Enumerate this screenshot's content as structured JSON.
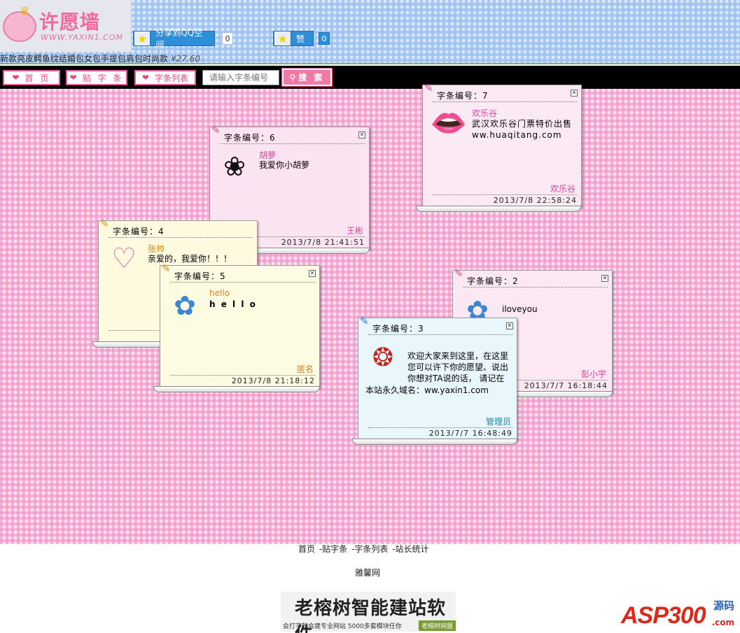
{
  "header": {
    "logo_title": "许愿墙",
    "logo_url": "WWW.YAXIN1.COM",
    "share_qq_label": "分享到QQ空间",
    "share_qq_count": "0",
    "like_label": "赞",
    "like_count": "0"
  },
  "ad": {
    "text": "新款亮皮鳄鱼纹结婚包女包手提包肩包时尚款",
    "price": "¥27.60"
  },
  "nav": {
    "home": "首 页",
    "post": "贴 字 条",
    "list": "字条列表",
    "search_placeholder": "请输入字条编号",
    "search_button": "搜 索"
  },
  "notes": [
    {
      "id": "7",
      "label": "字条编号：7",
      "name": "欢乐谷",
      "message": "武汉欢乐谷门票特价出售 ww.huaqitang.com",
      "sign": "欢乐谷",
      "date": "2013/7/8 22:58:24",
      "icon": "lips-icon",
      "bg": "#fbeaf4"
    },
    {
      "id": "6",
      "label": "字条编号：6",
      "name": "胡萝",
      "message": "我爱你小胡萝",
      "sign": "王彬",
      "date": "2013/7/8 21:41:51",
      "icon": "rose-icon",
      "bg": "#fbe4f1"
    },
    {
      "id": "4",
      "label": "字条编号：4",
      "name": "张帅",
      "message": "亲爱的，我爱你！！！",
      "sign": "",
      "date": "",
      "icon": "love-heart-icon",
      "bg": "#fdfae0"
    },
    {
      "id": "5",
      "label": "字条编号：5",
      "name": "hello",
      "message": "h e l l o",
      "sign": "匿名",
      "date": "2013/7/8 21:18:12",
      "icon": "blue-flowers-icon",
      "bg": "#fdfbe2"
    },
    {
      "id": "2",
      "label": "字条编号：2",
      "name": "",
      "message": "iloveyou",
      "sign": "彭小宇",
      "date": "2013/7/7 16:18:44",
      "icon": "blue-flowers-icon",
      "bg": "#fbe8f3"
    },
    {
      "id": "3",
      "label": "字条编号：3",
      "name": "",
      "message": "欢迎大家来到这里，在这里您可以许下你的愿望、说出你想对TA说的话， 请记在",
      "message2": "本站永久域名：ww.yaxin1.com",
      "sign": "管理员",
      "date": "2013/7/7 16:48:49",
      "icon": "fortune-bag-icon",
      "bg": "#e9f6fb"
    }
  ],
  "colors": {
    "pink_accent": "#e8457f",
    "name_pink": "#d0449a",
    "name_orange": "#d4861a",
    "sign_teal": "#1a8aa8"
  },
  "footer": {
    "link_home": "首页",
    "link_post": "-贴字条",
    "link_list": "-字条列表",
    "link_stats": "-站长统计",
    "site_name": "雅馨网",
    "banner_title": "老榕树智能建站软件",
    "banner_sub": "会打字就会建专业网站  5000多套模块任你",
    "banner_tag": "老榕树网盟",
    "asp_logo": "ASP300",
    "asp_yuanma": "源码",
    "asp_com": ".com"
  }
}
